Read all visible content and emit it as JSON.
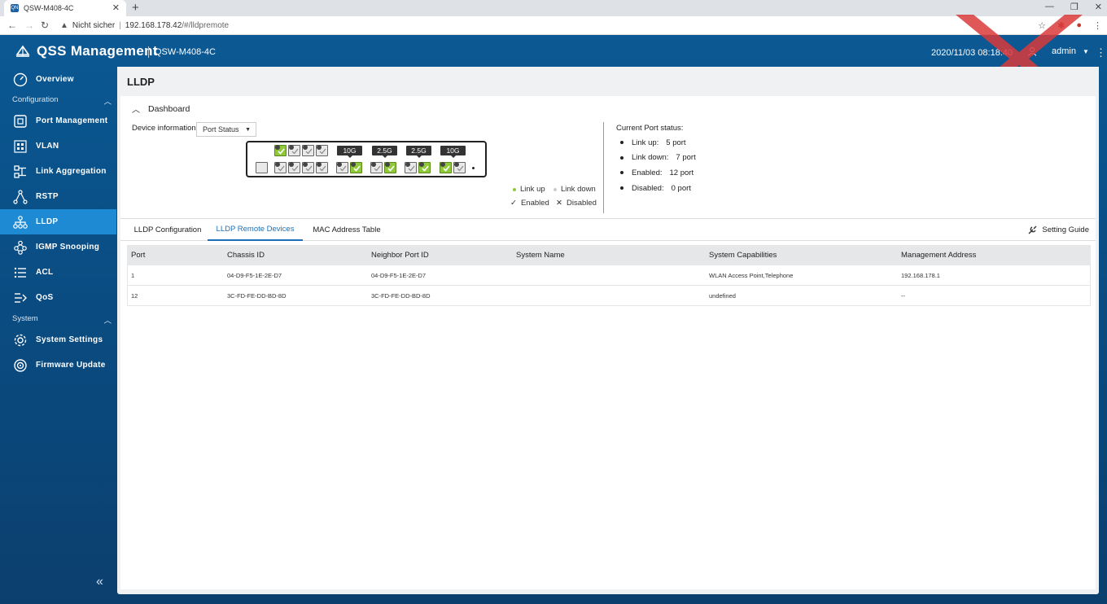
{
  "browser": {
    "tab_title": "QSW-M408-4C",
    "fav_text": "QN",
    "security_text": "Nicht sicher",
    "url_host": "192.168.178.42",
    "url_path": "/#/lldpremote",
    "new_tab": "+"
  },
  "header": {
    "app_title": "QSS Management",
    "device_name": "QSW-M408-4C",
    "datetime": "2020/11/03 08:18:40",
    "user": "admin"
  },
  "sidebar": {
    "items": [
      {
        "label": "Overview",
        "icon": "gauge-icon"
      },
      {
        "label": "Port Management",
        "icon": "port-icon"
      },
      {
        "label": "VLAN",
        "icon": "vlan-icon"
      },
      {
        "label": "Link Aggregation",
        "icon": "link-aggregation-icon"
      },
      {
        "label": "RSTP",
        "icon": "rstp-icon"
      },
      {
        "label": "LLDP",
        "icon": "lldp-icon"
      },
      {
        "label": "IGMP Snooping",
        "icon": "igmp-icon"
      },
      {
        "label": "ACL",
        "icon": "acl-icon"
      },
      {
        "label": "QoS",
        "icon": "qos-icon"
      },
      {
        "label": "System Settings",
        "icon": "gear-icon"
      },
      {
        "label": "Firmware Update",
        "icon": "firmware-icon"
      }
    ],
    "sections": {
      "configuration": "Configuration",
      "system": "System"
    },
    "collapse_glyph": "«"
  },
  "page": {
    "title": "LLDP",
    "dashboard_label": "Dashboard",
    "device_info_label": "Device information:",
    "device_info_value": "Port Status",
    "speeds": [
      "10G",
      "2.5G",
      "2.5G",
      "10G"
    ],
    "legend": {
      "link_up": "Link up",
      "link_down": "Link down",
      "enabled": "Enabled",
      "disabled": "Disabled"
    },
    "port_status": {
      "title": "Current Port status:",
      "items": [
        {
          "label": "Link up:",
          "value": "5 port"
        },
        {
          "label": "Link down:",
          "value": "7 port"
        },
        {
          "label": "Enabled:",
          "value": "12 port"
        },
        {
          "label": "Disabled:",
          "value": "0 port"
        }
      ]
    },
    "tabs": [
      "LLDP Configuration",
      "LLDP Remote Devices",
      "MAC Address Table"
    ],
    "active_tab": 1,
    "setting_guide": "Setting Guide"
  },
  "table": {
    "headers": [
      "Port",
      "Chassis ID",
      "Neighbor Port ID",
      "System Name",
      "System Capabilities",
      "Management Address"
    ],
    "rows": [
      [
        "1",
        "04-D9-F5-1E-2E-D7",
        "04-D9-F5-1E-2E-D7",
        "",
        "WLAN Access Point,Telephone",
        "192.168.178.1"
      ],
      [
        "12",
        "3C-FD-FE-DD-BD-8D",
        "3C-FD-FE-DD-BD-8D",
        "",
        "undefined",
        "--"
      ]
    ]
  },
  "colors": {
    "accent": "#1d8ad3",
    "link_up": "#8fc93a",
    "header_bg": "#0b5a96",
    "watermark": "#d93a3a"
  }
}
